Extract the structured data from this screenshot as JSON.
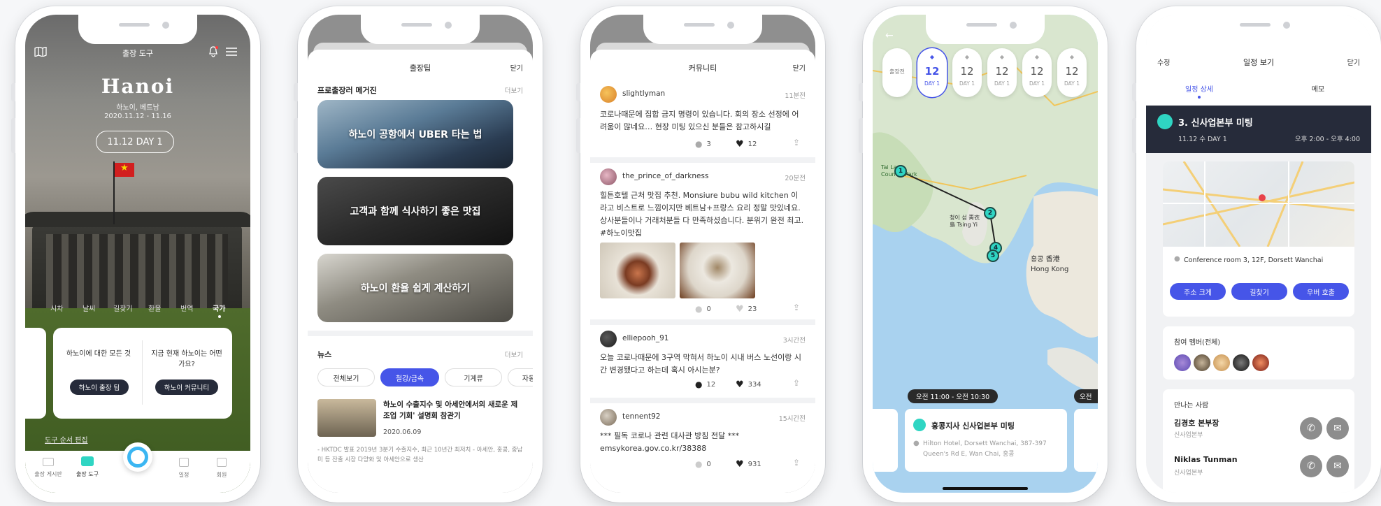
{
  "phone1": {
    "title": "출장 도구",
    "city": "Hanoi",
    "country": "하노이, 베트남",
    "dates": "2020.11.12 - 11.16",
    "day_button": "11.12 DAY 1",
    "tabs": [
      "시차",
      "날씨",
      "길찾기",
      "환율",
      "번역",
      "국가"
    ],
    "card_left_text": "하노이에 대한 모든 것",
    "card_left_button": "하노이 출장 팁",
    "card_right_text": "지금 현재 하노이는 어떤가요?",
    "card_right_button": "하노이 커뮤니티",
    "edit_order": "도구 순서 편집",
    "nav": [
      "출장 게시판",
      "출장 도구",
      "",
      "일정",
      "회원"
    ]
  },
  "phone2": {
    "title": "출장팁",
    "close": "닫기",
    "mag_heading": "프로출장러 메거진",
    "more": "더보기",
    "cards": [
      "하노이 공항에서 UBER 타는 법",
      "고객과 함께 식사하기 좋은 맛집",
      "하노이 환율 쉽게 계산하기"
    ],
    "news_heading": "뉴스",
    "news_more": "더보기",
    "chips": [
      "전체보기",
      "철강/금속",
      "기계류",
      "자동"
    ],
    "news_title": "하노이 수출지수 및 아세안에서의 새로운 제조업 기회' 설명회 참관기",
    "news_date": "2020.06.09",
    "news_snippet": "- HKTDC 발표 2019년 3분기 수출지수, 최근 10년간 최저치 - 아세안, 홍콩, 중남미 등 잔출 시장 다양화 및 아세안으로 생산"
  },
  "phone3": {
    "title": "커뮤니티",
    "close": "닫기",
    "posts": [
      {
        "user": "slightlyman",
        "time": "11분전",
        "text": "코로나때문에 집합 금지 명령이 있습니다. 회의 장소 선정에 어려움이 많네요… 현장 미팅 있으신 분들은 참고하시길",
        "comments": "3",
        "likes": "12"
      },
      {
        "user": "the_prince_of_darkness",
        "time": "20분전",
        "text": "힐튼호텔 근처 맛집 추천. Monsiure bubu wild kitchen 이라고 비스트로 느낌이지만 베트남+프랑스 요리 정말 맛있네요. 상사분들이나 거래처분들 다 만족하셨습니다. 분위기 완전 최고. #하노이맛집",
        "comments": "0",
        "likes": "23"
      },
      {
        "user": "elliepooh_91",
        "time": "3시간전",
        "text": "오늘 코로나때문에 3구역 막혀서 하노이 시내 버스 노선이랑 시간 변경됐다고 하는데 혹시 아시는분?",
        "comments": "12",
        "likes": "334"
      },
      {
        "user": "tennent92",
        "time": "15시간전",
        "text": "*** 필독 코로나 관련 대사관 방침 전달 *** emsykorea.gov.co.kr/38388",
        "comments": "0",
        "likes": "931"
      }
    ]
  },
  "phone4": {
    "first_pill": "출장전",
    "days": [
      {
        "num": "12",
        "label": "DAY 1"
      },
      {
        "num": "12",
        "label": "DAY 1"
      },
      {
        "num": "12",
        "label": "DAY 1"
      },
      {
        "num": "12",
        "label": "DAY 1"
      },
      {
        "num": "12",
        "label": "DAY 1"
      }
    ],
    "map_labels": {
      "tai_lam": "Tai Lam Country Park",
      "tsing_yi": "청이 섬 靑衣島 Tsing Yi",
      "hong_kong": "홍콩 香港 Hong Kong"
    },
    "pins": [
      "1",
      "2",
      "4",
      "5"
    ],
    "time_tag": "오전 11:00 - 오전 10:30",
    "time_tag_2": "오전",
    "event_title": "홍콩지사 신사업본부 미팅",
    "event_address": "Hilton Hotel, Dorsett Wanchai, 387-397 Queen's Rd E, Wan Chai, 홍콩"
  },
  "phone5": {
    "edit": "수정",
    "title": "일정 보기",
    "close": "닫기",
    "tab_detail": "일정 상세",
    "tab_memo": "메모",
    "event_title": "3. 신사업본부 미팅",
    "event_date": "11.12 수 DAY 1",
    "event_time": "오후 2:00 - 오후 4:00",
    "location": "Conference room 3, 12F, Dorsett Wanchai",
    "buttons": [
      "주소 크게",
      "길찾기",
      "우버 호출"
    ],
    "members_heading": "참여 멤버(전체)",
    "people_heading": "만나는 사람",
    "people": [
      {
        "name": "김경호 본부장",
        "role": "신사업본부"
      },
      {
        "name": "Niklas Tunman",
        "role": "신사업본부"
      }
    ]
  }
}
